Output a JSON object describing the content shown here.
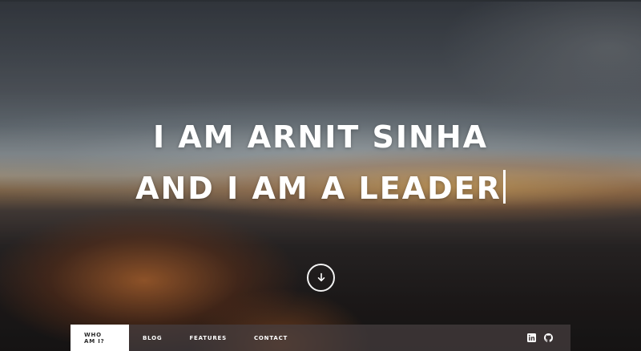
{
  "hero": {
    "line1": "I AM ARNIT SINHA",
    "line2": "AND I AM A LEADER"
  },
  "scroll_button": {
    "icon": "arrow-down-icon"
  },
  "nav": {
    "items": [
      {
        "label": "WHO AM I?",
        "active": true
      },
      {
        "label": "BLOG",
        "active": false
      },
      {
        "label": "FEATURES",
        "active": false
      },
      {
        "label": "CONTACT",
        "active": false
      }
    ],
    "social": [
      {
        "icon": "linkedin-icon"
      },
      {
        "icon": "github-icon"
      }
    ]
  },
  "colors": {
    "text": "#ffffff",
    "nav_background": "#463e40",
    "nav_active_background": "#ffffff",
    "nav_active_text": "#2a2a2a"
  }
}
